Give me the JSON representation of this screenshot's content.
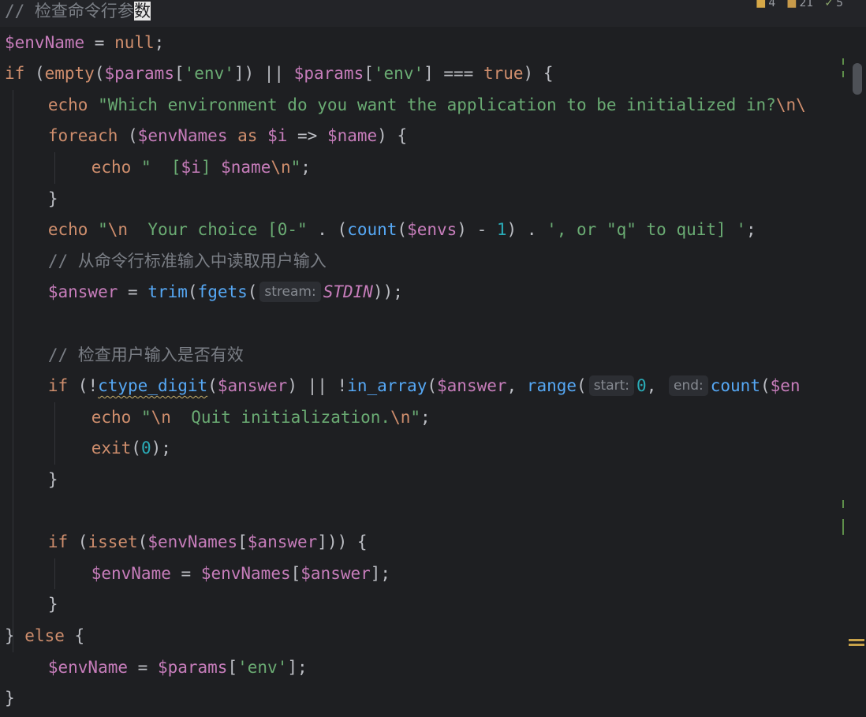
{
  "colors": {
    "background": "#1e1f22",
    "comment": "#7a7e85",
    "keyword": "#cf8e6d",
    "variable": "#c77dbb",
    "string": "#6aab73",
    "number": "#2aacb8",
    "function": "#56a8f5",
    "punctuation": "#bcbec4",
    "escape": "#cf8e6d"
  },
  "inspection_badges": [
    {
      "icon": "warning-icon",
      "count": "4"
    },
    {
      "icon": "weak-warning-icon",
      "count": "21"
    },
    {
      "icon": "typo-icon",
      "count": "5"
    }
  ],
  "code_lines": [
    {
      "segments": [
        {
          "t": "// 检查命令行参",
          "c": "comment"
        },
        {
          "t": "数",
          "c": "comment-hl"
        }
      ]
    },
    {
      "segments": [
        {
          "t": "$envName",
          "c": "variable"
        },
        {
          "t": " = ",
          "c": "punctuation"
        },
        {
          "t": "null",
          "c": "keyword"
        },
        {
          "t": ";",
          "c": "punctuation"
        }
      ]
    },
    {
      "segments": [
        {
          "t": "if",
          "c": "keyword"
        },
        {
          "t": " (",
          "c": "punctuation"
        },
        {
          "t": "empty",
          "c": "keyword"
        },
        {
          "t": "(",
          "c": "punctuation"
        },
        {
          "t": "$params",
          "c": "variable"
        },
        {
          "t": "[",
          "c": "punctuation"
        },
        {
          "t": "'env'",
          "c": "string"
        },
        {
          "t": "]) || ",
          "c": "punctuation"
        },
        {
          "t": "$params",
          "c": "variable"
        },
        {
          "t": "[",
          "c": "punctuation"
        },
        {
          "t": "'env'",
          "c": "string"
        },
        {
          "t": "] === ",
          "c": "punctuation"
        },
        {
          "t": "true",
          "c": "keyword"
        },
        {
          "t": ") {",
          "c": "punctuation"
        }
      ]
    },
    {
      "indent": 2,
      "segments": [
        {
          "t": "echo",
          "c": "keyword"
        },
        {
          "t": " ",
          "c": "punctuation"
        },
        {
          "t": "\"Which environment do you want the application to be initialized in?",
          "c": "string"
        },
        {
          "t": "\\n",
          "c": "escape"
        },
        {
          "t": "\\",
          "c": "escape"
        }
      ]
    },
    {
      "indent": 2,
      "segments": [
        {
          "t": "foreach",
          "c": "keyword"
        },
        {
          "t": " (",
          "c": "punctuation"
        },
        {
          "t": "$envNames",
          "c": "variable"
        },
        {
          "t": " ",
          "c": "punctuation"
        },
        {
          "t": "as",
          "c": "keyword"
        },
        {
          "t": " ",
          "c": "punctuation"
        },
        {
          "t": "$i",
          "c": "variable"
        },
        {
          "t": " => ",
          "c": "punctuation"
        },
        {
          "t": "$name",
          "c": "variable"
        },
        {
          "t": ") {",
          "c": "punctuation"
        }
      ]
    },
    {
      "indent": 4,
      "segments": [
        {
          "t": "echo",
          "c": "keyword"
        },
        {
          "t": " ",
          "c": "punctuation"
        },
        {
          "t": "\"  [",
          "c": "string"
        },
        {
          "t": "$i",
          "c": "variable"
        },
        {
          "t": "] ",
          "c": "string"
        },
        {
          "t": "$name",
          "c": "variable"
        },
        {
          "t": "\\n",
          "c": "escape"
        },
        {
          "t": "\"",
          "c": "string"
        },
        {
          "t": ";",
          "c": "punctuation"
        }
      ]
    },
    {
      "indent": 2,
      "segments": [
        {
          "t": "}",
          "c": "punctuation"
        }
      ]
    },
    {
      "indent": 2,
      "segments": [
        {
          "t": "echo",
          "c": "keyword"
        },
        {
          "t": " ",
          "c": "punctuation"
        },
        {
          "t": "\"",
          "c": "string"
        },
        {
          "t": "\\n",
          "c": "escape"
        },
        {
          "t": "  Your choice [0-\"",
          "c": "string"
        },
        {
          "t": " . (",
          "c": "punctuation"
        },
        {
          "t": "count",
          "c": "function"
        },
        {
          "t": "(",
          "c": "punctuation"
        },
        {
          "t": "$envs",
          "c": "variable"
        },
        {
          "t": ") - ",
          "c": "punctuation"
        },
        {
          "t": "1",
          "c": "number"
        },
        {
          "t": ") . ",
          "c": "punctuation"
        },
        {
          "t": "', or \"q\" to quit] '",
          "c": "string"
        },
        {
          "t": ";",
          "c": "punctuation"
        }
      ]
    },
    {
      "indent": 2,
      "segments": [
        {
          "t": "// 从命令行标准输入中读取用户输入",
          "c": "comment"
        }
      ]
    },
    {
      "indent": 2,
      "segments": [
        {
          "t": "$answer",
          "c": "variable"
        },
        {
          "t": " = ",
          "c": "punctuation"
        },
        {
          "t": "trim",
          "c": "function"
        },
        {
          "t": "(",
          "c": "punctuation"
        },
        {
          "t": "fgets",
          "c": "function"
        },
        {
          "t": "(",
          "c": "punctuation"
        },
        {
          "t": "stream:",
          "c": "hint"
        },
        {
          "t": "STDIN",
          "c": "constant"
        },
        {
          "t": "));",
          "c": "punctuation"
        }
      ]
    },
    {
      "segments": []
    },
    {
      "indent": 2,
      "segments": [
        {
          "t": "// 检查用户输入是否有效",
          "c": "comment"
        }
      ]
    },
    {
      "indent": 2,
      "segments": [
        {
          "t": "if",
          "c": "keyword"
        },
        {
          "t": " (!",
          "c": "punctuation"
        },
        {
          "t": "ctype_digit",
          "c": "function-wavy"
        },
        {
          "t": "(",
          "c": "punctuation"
        },
        {
          "t": "$answer",
          "c": "variable"
        },
        {
          "t": ") || !",
          "c": "punctuation"
        },
        {
          "t": "in_array",
          "c": "function"
        },
        {
          "t": "(",
          "c": "punctuation"
        },
        {
          "t": "$answer",
          "c": "variable"
        },
        {
          "t": ", ",
          "c": "punctuation"
        },
        {
          "t": "range",
          "c": "function"
        },
        {
          "t": "(",
          "c": "punctuation"
        },
        {
          "t": "start:",
          "c": "hint"
        },
        {
          "t": "0",
          "c": "number"
        },
        {
          "t": ", ",
          "c": "punctuation"
        },
        {
          "t": "end:",
          "c": "hint"
        },
        {
          "t": "count",
          "c": "function"
        },
        {
          "t": "(",
          "c": "punctuation"
        },
        {
          "t": "$en",
          "c": "variable"
        }
      ]
    },
    {
      "indent": 4,
      "segments": [
        {
          "t": "echo",
          "c": "keyword"
        },
        {
          "t": " ",
          "c": "punctuation"
        },
        {
          "t": "\"",
          "c": "string"
        },
        {
          "t": "\\n",
          "c": "escape"
        },
        {
          "t": "  Quit initialization.",
          "c": "string"
        },
        {
          "t": "\\n",
          "c": "escape"
        },
        {
          "t": "\"",
          "c": "string"
        },
        {
          "t": ";",
          "c": "punctuation"
        }
      ]
    },
    {
      "indent": 4,
      "segments": [
        {
          "t": "exit",
          "c": "keyword"
        },
        {
          "t": "(",
          "c": "punctuation"
        },
        {
          "t": "0",
          "c": "number"
        },
        {
          "t": ");",
          "c": "punctuation"
        }
      ]
    },
    {
      "indent": 2,
      "segments": [
        {
          "t": "}",
          "c": "punctuation"
        }
      ]
    },
    {
      "segments": []
    },
    {
      "indent": 2,
      "segments": [
        {
          "t": "if",
          "c": "keyword"
        },
        {
          "t": " (",
          "c": "punctuation"
        },
        {
          "t": "isset",
          "c": "keyword"
        },
        {
          "t": "(",
          "c": "punctuation"
        },
        {
          "t": "$envNames",
          "c": "variable"
        },
        {
          "t": "[",
          "c": "punctuation"
        },
        {
          "t": "$answer",
          "c": "variable"
        },
        {
          "t": "])) {",
          "c": "punctuation"
        }
      ]
    },
    {
      "indent": 4,
      "segments": [
        {
          "t": "$envName",
          "c": "variable"
        },
        {
          "t": " = ",
          "c": "punctuation"
        },
        {
          "t": "$envNames",
          "c": "variable"
        },
        {
          "t": "[",
          "c": "punctuation"
        },
        {
          "t": "$answer",
          "c": "variable"
        },
        {
          "t": "];",
          "c": "punctuation"
        }
      ]
    },
    {
      "indent": 2,
      "segments": [
        {
          "t": "}",
          "c": "punctuation"
        }
      ]
    },
    {
      "segments": [
        {
          "t": "} ",
          "c": "punctuation"
        },
        {
          "t": "else",
          "c": "keyword"
        },
        {
          "t": " {",
          "c": "punctuation"
        }
      ]
    },
    {
      "indent": 2,
      "segments": [
        {
          "t": "$envName",
          "c": "variable"
        },
        {
          "t": " = ",
          "c": "punctuation"
        },
        {
          "t": "$params",
          "c": "variable"
        },
        {
          "t": "[",
          "c": "punctuation"
        },
        {
          "t": "'env'",
          "c": "string"
        },
        {
          "t": "];",
          "c": "punctuation"
        }
      ]
    },
    {
      "segments": [
        {
          "t": "}",
          "c": "punctuation"
        }
      ]
    }
  ]
}
